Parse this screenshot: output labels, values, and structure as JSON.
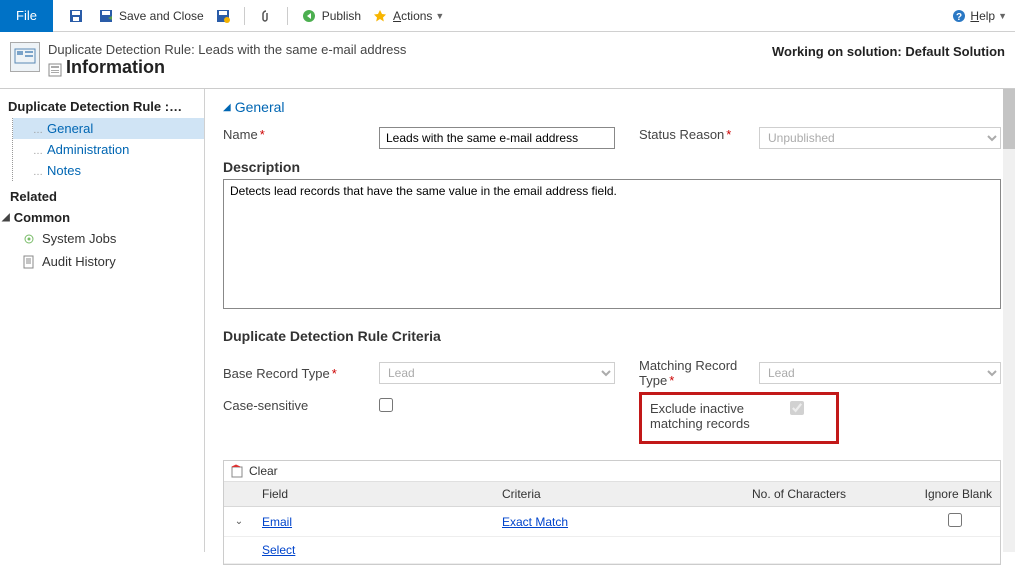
{
  "toolbar": {
    "file_tab": "File",
    "save_close_label": "Save and Close",
    "publish_label": "Publish",
    "actions_label": "Actions",
    "help_label": "Help"
  },
  "header": {
    "breadcrumb": "Duplicate Detection Rule: Leads with the same e-mail address",
    "title": "Information",
    "working_on": "Working on solution: Default Solution"
  },
  "sidebar": {
    "heading": "Duplicate Detection Rule :…",
    "items": [
      "General",
      "Administration",
      "Notes"
    ],
    "related_label": "Related",
    "common_label": "Common",
    "links": [
      {
        "label": "System Jobs",
        "icon": "gear"
      },
      {
        "label": "Audit History",
        "icon": "doc"
      }
    ]
  },
  "main": {
    "general_section": "General",
    "name_label": "Name",
    "name_value": "Leads with the same e-mail address",
    "status_label": "Status Reason",
    "status_value": "Unpublished",
    "description_label": "Description",
    "description_value": "Detects lead records that have the same value in the email address field.",
    "criteria_title": "Duplicate Detection Rule Criteria",
    "base_type_label": "Base Record Type",
    "base_type_value": "Lead",
    "case_sensitive_label": "Case-sensitive",
    "matching_type_label": "Matching Record Type",
    "matching_type_value": "Lead",
    "exclude_inactive_label": "Exclude inactive matching records",
    "clear_label": "Clear",
    "columns": {
      "field": "Field",
      "criteria": "Criteria",
      "chars": "No. of Characters",
      "ignore": "Ignore Blank"
    },
    "rows": [
      {
        "field": "Email",
        "criteria": "Exact Match",
        "chars": "",
        "ignore": false
      }
    ],
    "select_label": "Select"
  }
}
